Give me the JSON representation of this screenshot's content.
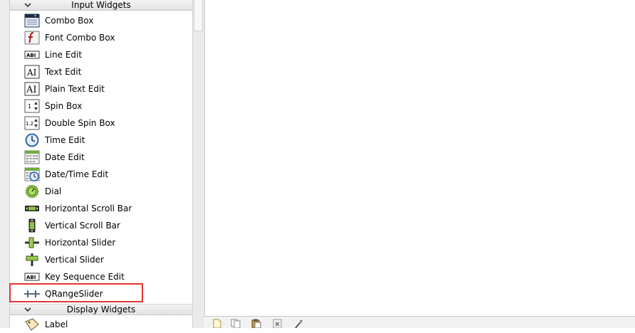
{
  "categories": {
    "input": "Input Widgets",
    "display": "Display Widgets"
  },
  "input_items": [
    {
      "label": "Combo Box",
      "icon": "combo-box-icon"
    },
    {
      "label": "Font Combo Box",
      "icon": "font-combo-box-icon"
    },
    {
      "label": "Line Edit",
      "icon": "line-edit-icon"
    },
    {
      "label": "Text Edit",
      "icon": "text-edit-icon"
    },
    {
      "label": "Plain Text Edit",
      "icon": "plain-text-edit-icon"
    },
    {
      "label": "Spin Box",
      "icon": "spin-box-icon"
    },
    {
      "label": "Double Spin Box",
      "icon": "double-spin-box-icon"
    },
    {
      "label": "Time Edit",
      "icon": "time-edit-icon"
    },
    {
      "label": "Date Edit",
      "icon": "date-edit-icon"
    },
    {
      "label": "Date/Time Edit",
      "icon": "date-time-edit-icon"
    },
    {
      "label": "Dial",
      "icon": "dial-icon"
    },
    {
      "label": "Horizontal Scroll Bar",
      "icon": "horizontal-scroll-bar-icon"
    },
    {
      "label": "Vertical Scroll Bar",
      "icon": "vertical-scroll-bar-icon"
    },
    {
      "label": "Horizontal Slider",
      "icon": "horizontal-slider-icon"
    },
    {
      "label": "Vertical Slider",
      "icon": "vertical-slider-icon"
    },
    {
      "label": "Key Sequence Edit",
      "icon": "key-sequence-edit-icon"
    },
    {
      "label": "QRangeSlider",
      "icon": "range-slider-icon"
    }
  ],
  "display_items": [
    {
      "label": "Label",
      "icon": "label-icon"
    }
  ],
  "icon_glyphs": {
    "line_edit": "ABI",
    "text_edit": "AI",
    "spin": "1",
    "double_spin": "1.2"
  },
  "colors": {
    "highlight_border": "#e53535"
  },
  "toolbar_buttons": [
    "new-icon",
    "copy-icon",
    "paste-icon",
    "delete-icon",
    "tools-icon"
  ]
}
